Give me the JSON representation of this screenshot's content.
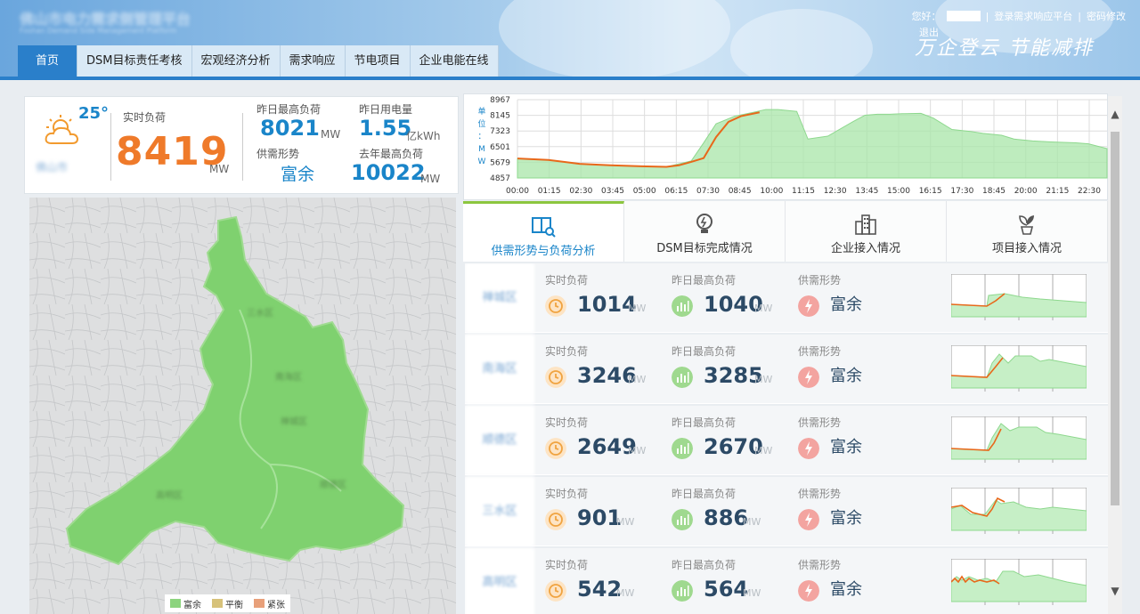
{
  "header": {
    "logo_title": "佛山市电力需求侧管理平台",
    "logo_subtitle": "Foshan Demand Side Management Platform",
    "greeting": "您好：",
    "links": [
      "登录需求响应平台",
      "密码修改"
    ],
    "logout": "退出",
    "slogan": "万企登云  节能减排"
  },
  "nav": {
    "tabs": [
      "首页",
      "DSM目标责任考核",
      "宏观经济分析",
      "需求响应",
      "节电项目",
      "企业电能在线"
    ],
    "active": 0
  },
  "summary": {
    "temperature": "25°",
    "city": "佛山市",
    "realtime_label": "实时负荷",
    "realtime_value": "8419",
    "realtime_unit": "MW",
    "yesterday_max_label": "昨日最高负荷",
    "yesterday_max_value": "8021",
    "yesterday_max_unit": "MW",
    "yesterday_energy_label": "昨日用电量",
    "yesterday_energy_value": "1.55",
    "yesterday_energy_unit": "亿kWh",
    "supply_label": "供需形势",
    "supply_value": "富余",
    "lastyear_max_label": "去年最高负荷",
    "lastyear_max_value": "10022",
    "lastyear_max_unit": "MW"
  },
  "chart_data": {
    "type": "area",
    "ylabel": "单位：MW",
    "yticks": [
      8967,
      8145,
      7323,
      6501,
      5679,
      4857
    ],
    "ylim": [
      4857,
      8967
    ],
    "xticks": [
      "00:00",
      "01:15",
      "02:30",
      "03:45",
      "05:00",
      "06:15",
      "07:30",
      "08:45",
      "10:00",
      "11:15",
      "12:30",
      "13:45",
      "15:00",
      "16:15",
      "17:30",
      "18:45",
      "20:00",
      "21:15",
      "22:30"
    ],
    "grid": true,
    "series": [
      {
        "color": "#a8e6a8",
        "x": [
          0,
          1.25,
          2.5,
          3.75,
          5,
          6,
          7,
          7.5,
          8,
          8.75,
          9.5,
          10,
          10.5,
          11.25,
          11.7,
          12.5,
          13.5,
          14,
          14.5,
          15,
          15.5,
          16.25,
          16.75,
          17.5,
          18.25,
          18.75,
          19.5,
          20,
          20.75,
          21.5,
          22.5,
          23,
          23.75
        ],
        "y": [
          5880,
          5800,
          5600,
          5520,
          5470,
          5440,
          5750,
          6700,
          7700,
          8100,
          8300,
          8450,
          8450,
          8350,
          6900,
          7050,
          7800,
          8150,
          8200,
          8200,
          8230,
          8250,
          8000,
          7400,
          7300,
          7200,
          7100,
          6900,
          6800,
          6750,
          6700,
          6650,
          6400
        ]
      },
      {
        "color": "#e8681a",
        "x": [
          0,
          1.25,
          2.5,
          3.75,
          5,
          6,
          6.5,
          7,
          7.5,
          8,
          8.5,
          9,
          9.75
        ],
        "y": [
          5880,
          5800,
          5600,
          5520,
          5470,
          5440,
          5520,
          5700,
          5900,
          7000,
          7800,
          8100,
          8300
        ]
      }
    ]
  },
  "map": {
    "legend": [
      {
        "label": "富余",
        "color": "#8cd47e"
      },
      {
        "label": "平衡",
        "color": "#d7c27a"
      },
      {
        "label": "紧张",
        "color": "#e8a07a"
      }
    ],
    "district_labels": [
      "三水区",
      "南海区",
      "禅城区",
      "高明区",
      "顺德区"
    ]
  },
  "tabs": [
    {
      "label": "供需形势与负荷分析",
      "icon": "book-search-icon"
    },
    {
      "label": "DSM目标完成情况",
      "icon": "lightbulb-icon"
    },
    {
      "label": "企业接入情况",
      "icon": "buildings-icon"
    },
    {
      "label": "项目接入情况",
      "icon": "plant-pot-icon"
    }
  ],
  "rows": [
    {
      "name": "禅城区",
      "rt_label": "实时负荷",
      "rt": "1014",
      "unit": "MW",
      "ymax_label": "昨日最高负荷",
      "ymax": "1040",
      "sd_label": "供需形势",
      "sd": "富余"
    },
    {
      "name": "南海区",
      "rt_label": "实时负荷",
      "rt": "3246",
      "unit": "MW",
      "ymax_label": "昨日最高负荷",
      "ymax": "3285",
      "sd_label": "供需形势",
      "sd": "富余"
    },
    {
      "name": "顺德区",
      "rt_label": "实时负荷",
      "rt": "2649",
      "unit": "MW",
      "ymax_label": "昨日最高负荷",
      "ymax": "2670",
      "sd_label": "供需形势",
      "sd": "富余"
    },
    {
      "name": "三水区",
      "rt_label": "实时负荷",
      "rt": "901",
      "unit": "MW",
      "ymax_label": "昨日最高负荷",
      "ymax": "886",
      "sd_label": "供需形势",
      "sd": "富余"
    },
    {
      "name": "高明区",
      "rt_label": "实时负荷",
      "rt": "542",
      "unit": "MW",
      "ymax_label": "昨日最高负荷",
      "ymax": "564",
      "sd_label": "供需形势",
      "sd": "富余"
    }
  ]
}
